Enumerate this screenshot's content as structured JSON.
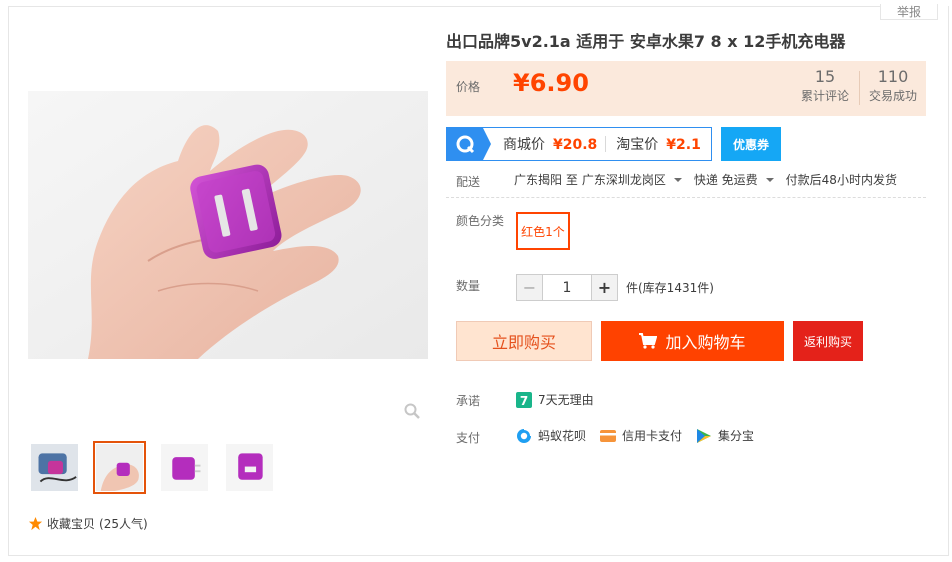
{
  "report_label": "举报",
  "title": "出口品牌5v2.1a 适用于 安卓水果7 8 x 12手机充电器",
  "price": {
    "label": "价格",
    "currency": "¥",
    "value": "6.90"
  },
  "stats": [
    {
      "num": "15",
      "label": "累计评论"
    },
    {
      "num": "110",
      "label": "交易成功"
    }
  ],
  "coupon": {
    "mall_label": "商城价",
    "mall_price": "¥20.8",
    "taobao_label": "淘宝价",
    "taobao_price": "¥2.1",
    "button": "优惠券"
  },
  "delivery": {
    "label": "配送",
    "from": "广东揭阳 至",
    "to": "广东深圳龙岗区",
    "method": "快递 免运费",
    "note": "付款后48小时内发货"
  },
  "color": {
    "label": "颜色分类",
    "option": "红色1个"
  },
  "quantity": {
    "label": "数量",
    "value": "1",
    "minus": "−",
    "plus": "+",
    "stock": "件(库存1431件)"
  },
  "actions": {
    "buy": "立即购买",
    "cart": "加入购物车",
    "rebate": "返利购买"
  },
  "promise": {
    "label": "承诺",
    "badge": "7",
    "text": "7天无理由"
  },
  "payment": {
    "label": "支付",
    "methods": [
      {
        "name": "蚂蚁花呗",
        "icon": "huabei-icon"
      },
      {
        "name": "信用卡支付",
        "icon": "credit-card-icon"
      },
      {
        "name": "集分宝",
        "icon": "jifenbao-icon"
      }
    ]
  },
  "collect": {
    "text": "收藏宝贝",
    "count": "(25人气)"
  },
  "colors": {
    "accent": "#ff4400",
    "price_bg": "#fbe9dc",
    "coupon_blue": "#2f8ff0",
    "cart_red": "#ff4200",
    "product_purple": "#b42dbd"
  }
}
